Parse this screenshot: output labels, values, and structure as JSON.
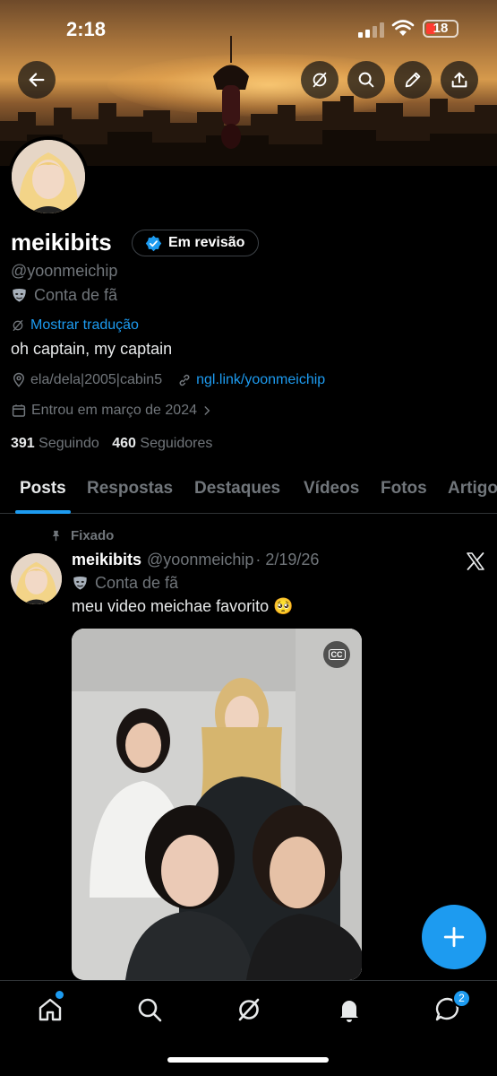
{
  "status_bar": {
    "time": "2:18",
    "battery": "18"
  },
  "profile": {
    "name": "meikibits",
    "badge_label": "Em revisão",
    "handle": "@yoonmeichip",
    "fan_label": "Conta de fã",
    "translate_label": "Mostrar tradução",
    "bio": "oh captain, my captain",
    "location": "ela/dela|2005|cabin5",
    "link": "ngl.link/yoonmeichip",
    "joined": "Entrou em março de 2024",
    "following_count": "391",
    "following_label": "Seguindo",
    "followers_count": "460",
    "followers_label": "Seguidores"
  },
  "tabs": [
    {
      "label": "Posts"
    },
    {
      "label": "Respostas"
    },
    {
      "label": "Destaques"
    },
    {
      "label": "Vídeos"
    },
    {
      "label": "Fotos"
    },
    {
      "label": "Artigo"
    }
  ],
  "post": {
    "pinned_label": "Fixado",
    "author_name": "meikibits",
    "author_handle": "@yoonmeichip",
    "date": "· 2/19/26",
    "fan_label": "Conta de fã",
    "text": "meu video meichae favorito 🥺",
    "cc_label": "CC"
  },
  "nav": {
    "messages_badge": "2"
  },
  "colors": {
    "accent": "#1d9bf0",
    "background": "#000000",
    "muted": "#71767b"
  }
}
